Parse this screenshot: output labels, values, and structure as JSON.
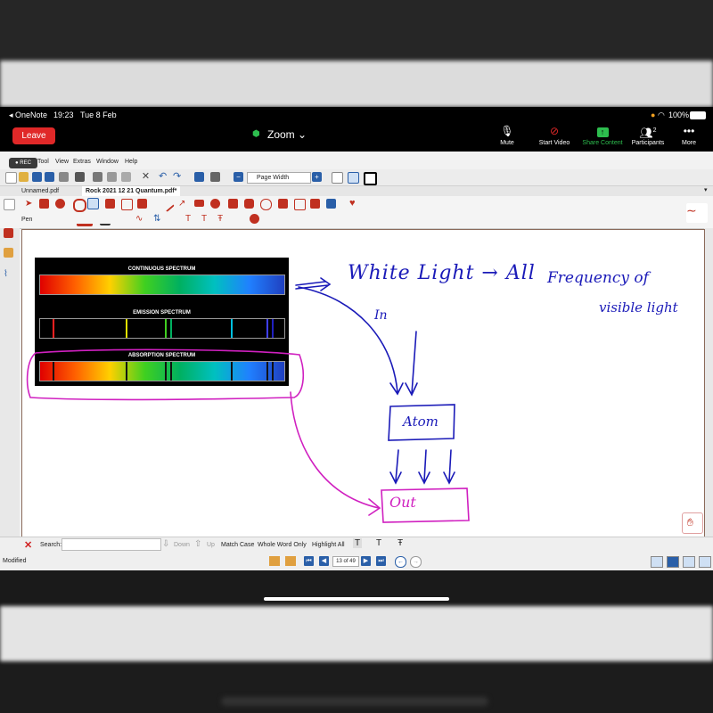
{
  "status_bar": {
    "back_app": "◂ OneNote",
    "time": "19:23",
    "date": "Tue 8 Feb",
    "battery": "100%"
  },
  "zoom": {
    "leave_label": "Leave",
    "title": "Zoom",
    "buttons": [
      {
        "label": "Mute",
        "icon": "microphone-icon"
      },
      {
        "label": "Start Video",
        "icon": "video-off-icon"
      },
      {
        "label": "Share Content",
        "icon": "share-icon"
      },
      {
        "label": "Participants",
        "icon": "participants-icon",
        "count": "2"
      },
      {
        "label": "More",
        "icon": "more-icon"
      }
    ],
    "accent": "#2dbd4e",
    "leave_color": "#e02828"
  },
  "rec_label": "● REC",
  "menu": [
    "Tool",
    "View",
    "Extras",
    "Window",
    "Help"
  ],
  "page_width_label": "Page Width",
  "tabs": [
    {
      "label": "Unnamed.pdf"
    },
    {
      "label": "Rock 2021 12 21 Quantum.pdf*"
    }
  ],
  "pen_label": "Pen",
  "spectrum": {
    "continuous": "CONTINUOUS SPECTRUM",
    "emission": "EMISSION SPECTRUM",
    "absorption": "ABSORPTION SPECTRUM"
  },
  "handwriting": {
    "line1": "White Light → All",
    "line1b": "Frequency of",
    "line2": "visible light",
    "in": "In",
    "atom": "Atom",
    "out": "Out"
  },
  "search": {
    "label": "Search:",
    "value": "",
    "down": "Down",
    "up": "Up",
    "match_case": "Match Case",
    "whole_word": "Whole Word Only",
    "highlight_all": "Highlight All"
  },
  "status": {
    "modified": "Modified",
    "page": "13 of 49"
  }
}
